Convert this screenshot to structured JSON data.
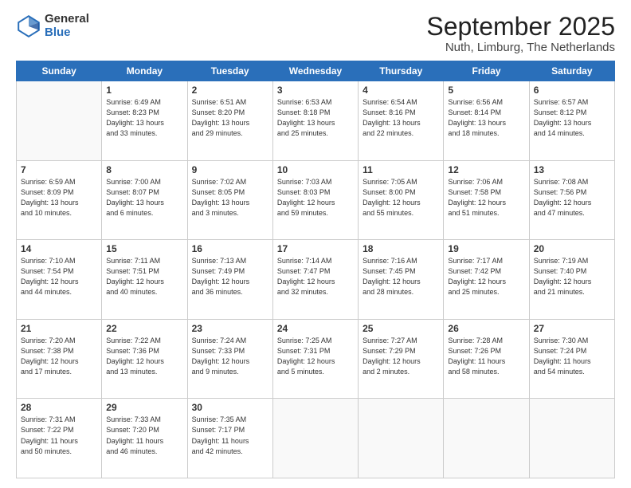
{
  "logo": {
    "general": "General",
    "blue": "Blue"
  },
  "header": {
    "month": "September 2025",
    "location": "Nuth, Limburg, The Netherlands"
  },
  "days": [
    "Sunday",
    "Monday",
    "Tuesday",
    "Wednesday",
    "Thursday",
    "Friday",
    "Saturday"
  ],
  "weeks": [
    [
      {
        "day": "",
        "info": ""
      },
      {
        "day": "1",
        "info": "Sunrise: 6:49 AM\nSunset: 8:23 PM\nDaylight: 13 hours\nand 33 minutes."
      },
      {
        "day": "2",
        "info": "Sunrise: 6:51 AM\nSunset: 8:20 PM\nDaylight: 13 hours\nand 29 minutes."
      },
      {
        "day": "3",
        "info": "Sunrise: 6:53 AM\nSunset: 8:18 PM\nDaylight: 13 hours\nand 25 minutes."
      },
      {
        "day": "4",
        "info": "Sunrise: 6:54 AM\nSunset: 8:16 PM\nDaylight: 13 hours\nand 22 minutes."
      },
      {
        "day": "5",
        "info": "Sunrise: 6:56 AM\nSunset: 8:14 PM\nDaylight: 13 hours\nand 18 minutes."
      },
      {
        "day": "6",
        "info": "Sunrise: 6:57 AM\nSunset: 8:12 PM\nDaylight: 13 hours\nand 14 minutes."
      }
    ],
    [
      {
        "day": "7",
        "info": "Sunrise: 6:59 AM\nSunset: 8:09 PM\nDaylight: 13 hours\nand 10 minutes."
      },
      {
        "day": "8",
        "info": "Sunrise: 7:00 AM\nSunset: 8:07 PM\nDaylight: 13 hours\nand 6 minutes."
      },
      {
        "day": "9",
        "info": "Sunrise: 7:02 AM\nSunset: 8:05 PM\nDaylight: 13 hours\nand 3 minutes."
      },
      {
        "day": "10",
        "info": "Sunrise: 7:03 AM\nSunset: 8:03 PM\nDaylight: 12 hours\nand 59 minutes."
      },
      {
        "day": "11",
        "info": "Sunrise: 7:05 AM\nSunset: 8:00 PM\nDaylight: 12 hours\nand 55 minutes."
      },
      {
        "day": "12",
        "info": "Sunrise: 7:06 AM\nSunset: 7:58 PM\nDaylight: 12 hours\nand 51 minutes."
      },
      {
        "day": "13",
        "info": "Sunrise: 7:08 AM\nSunset: 7:56 PM\nDaylight: 12 hours\nand 47 minutes."
      }
    ],
    [
      {
        "day": "14",
        "info": "Sunrise: 7:10 AM\nSunset: 7:54 PM\nDaylight: 12 hours\nand 44 minutes."
      },
      {
        "day": "15",
        "info": "Sunrise: 7:11 AM\nSunset: 7:51 PM\nDaylight: 12 hours\nand 40 minutes."
      },
      {
        "day": "16",
        "info": "Sunrise: 7:13 AM\nSunset: 7:49 PM\nDaylight: 12 hours\nand 36 minutes."
      },
      {
        "day": "17",
        "info": "Sunrise: 7:14 AM\nSunset: 7:47 PM\nDaylight: 12 hours\nand 32 minutes."
      },
      {
        "day": "18",
        "info": "Sunrise: 7:16 AM\nSunset: 7:45 PM\nDaylight: 12 hours\nand 28 minutes."
      },
      {
        "day": "19",
        "info": "Sunrise: 7:17 AM\nSunset: 7:42 PM\nDaylight: 12 hours\nand 25 minutes."
      },
      {
        "day": "20",
        "info": "Sunrise: 7:19 AM\nSunset: 7:40 PM\nDaylight: 12 hours\nand 21 minutes."
      }
    ],
    [
      {
        "day": "21",
        "info": "Sunrise: 7:20 AM\nSunset: 7:38 PM\nDaylight: 12 hours\nand 17 minutes."
      },
      {
        "day": "22",
        "info": "Sunrise: 7:22 AM\nSunset: 7:36 PM\nDaylight: 12 hours\nand 13 minutes."
      },
      {
        "day": "23",
        "info": "Sunrise: 7:24 AM\nSunset: 7:33 PM\nDaylight: 12 hours\nand 9 minutes."
      },
      {
        "day": "24",
        "info": "Sunrise: 7:25 AM\nSunset: 7:31 PM\nDaylight: 12 hours\nand 5 minutes."
      },
      {
        "day": "25",
        "info": "Sunrise: 7:27 AM\nSunset: 7:29 PM\nDaylight: 12 hours\nand 2 minutes."
      },
      {
        "day": "26",
        "info": "Sunrise: 7:28 AM\nSunset: 7:26 PM\nDaylight: 11 hours\nand 58 minutes."
      },
      {
        "day": "27",
        "info": "Sunrise: 7:30 AM\nSunset: 7:24 PM\nDaylight: 11 hours\nand 54 minutes."
      }
    ],
    [
      {
        "day": "28",
        "info": "Sunrise: 7:31 AM\nSunset: 7:22 PM\nDaylight: 11 hours\nand 50 minutes."
      },
      {
        "day": "29",
        "info": "Sunrise: 7:33 AM\nSunset: 7:20 PM\nDaylight: 11 hours\nand 46 minutes."
      },
      {
        "day": "30",
        "info": "Sunrise: 7:35 AM\nSunset: 7:17 PM\nDaylight: 11 hours\nand 42 minutes."
      },
      {
        "day": "",
        "info": ""
      },
      {
        "day": "",
        "info": ""
      },
      {
        "day": "",
        "info": ""
      },
      {
        "day": "",
        "info": ""
      }
    ]
  ]
}
